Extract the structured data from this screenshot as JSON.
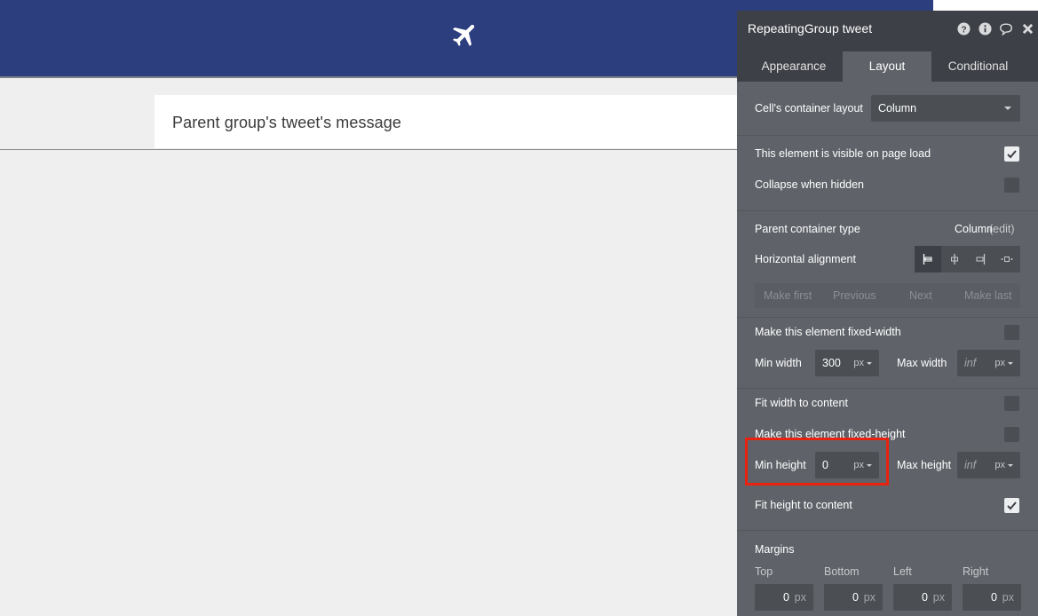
{
  "canvas": {
    "card_text": "Parent group's tweet's message",
    "header_icon": "airplane-icon"
  },
  "panel": {
    "title": "RepeatingGroup tweet",
    "title_icons": [
      "help-icon",
      "info-icon",
      "comment-icon",
      "close-icon"
    ],
    "tabs": [
      {
        "label": "Appearance",
        "active": false
      },
      {
        "label": "Layout",
        "active": true
      },
      {
        "label": "Conditional",
        "active": false
      }
    ],
    "cell_layout": {
      "label": "Cell's container layout",
      "value": "Column"
    },
    "visible_on_load": {
      "label": "This element is visible on page load",
      "checked": true
    },
    "collapse_hidden": {
      "label": "Collapse when hidden",
      "checked": false
    },
    "parent_container": {
      "label": "Parent container type",
      "value": "Column",
      "edit": "(edit)"
    },
    "horizontal_alignment": {
      "label": "Horizontal alignment",
      "options": [
        "align-left-icon",
        "align-center-icon",
        "align-right-icon",
        "align-spread-icon"
      ],
      "selected": 0
    },
    "order": [
      "Make first",
      "Previous",
      "Next",
      "Make last"
    ],
    "fixed_width": {
      "label": "Make this element fixed-width",
      "checked": false
    },
    "min_width": {
      "label": "Min width",
      "value": "300",
      "unit": "px"
    },
    "max_width": {
      "label": "Max width",
      "placeholder": "inf",
      "unit": "px"
    },
    "fit_width": {
      "label": "Fit width to content",
      "checked": false
    },
    "fixed_height": {
      "label": "Make this element fixed-height",
      "checked": false
    },
    "min_height": {
      "label": "Min height",
      "value": "0",
      "unit": "px"
    },
    "max_height": {
      "label": "Max height",
      "placeholder": "inf",
      "unit": "px"
    },
    "fit_height": {
      "label": "Fit height to content",
      "checked": true
    },
    "margins": {
      "label": "Margins",
      "fields": [
        {
          "label": "Top",
          "value": "0",
          "unit": "px"
        },
        {
          "label": "Bottom",
          "value": "0",
          "unit": "px"
        },
        {
          "label": "Left",
          "value": "0",
          "unit": "px"
        },
        {
          "label": "Right",
          "value": "0",
          "unit": "px"
        }
      ]
    }
  },
  "colors": {
    "header": "#2d3e7e",
    "panel": "#5f6369",
    "panel_dark": "#3d4046",
    "highlight": "#e8220e"
  }
}
